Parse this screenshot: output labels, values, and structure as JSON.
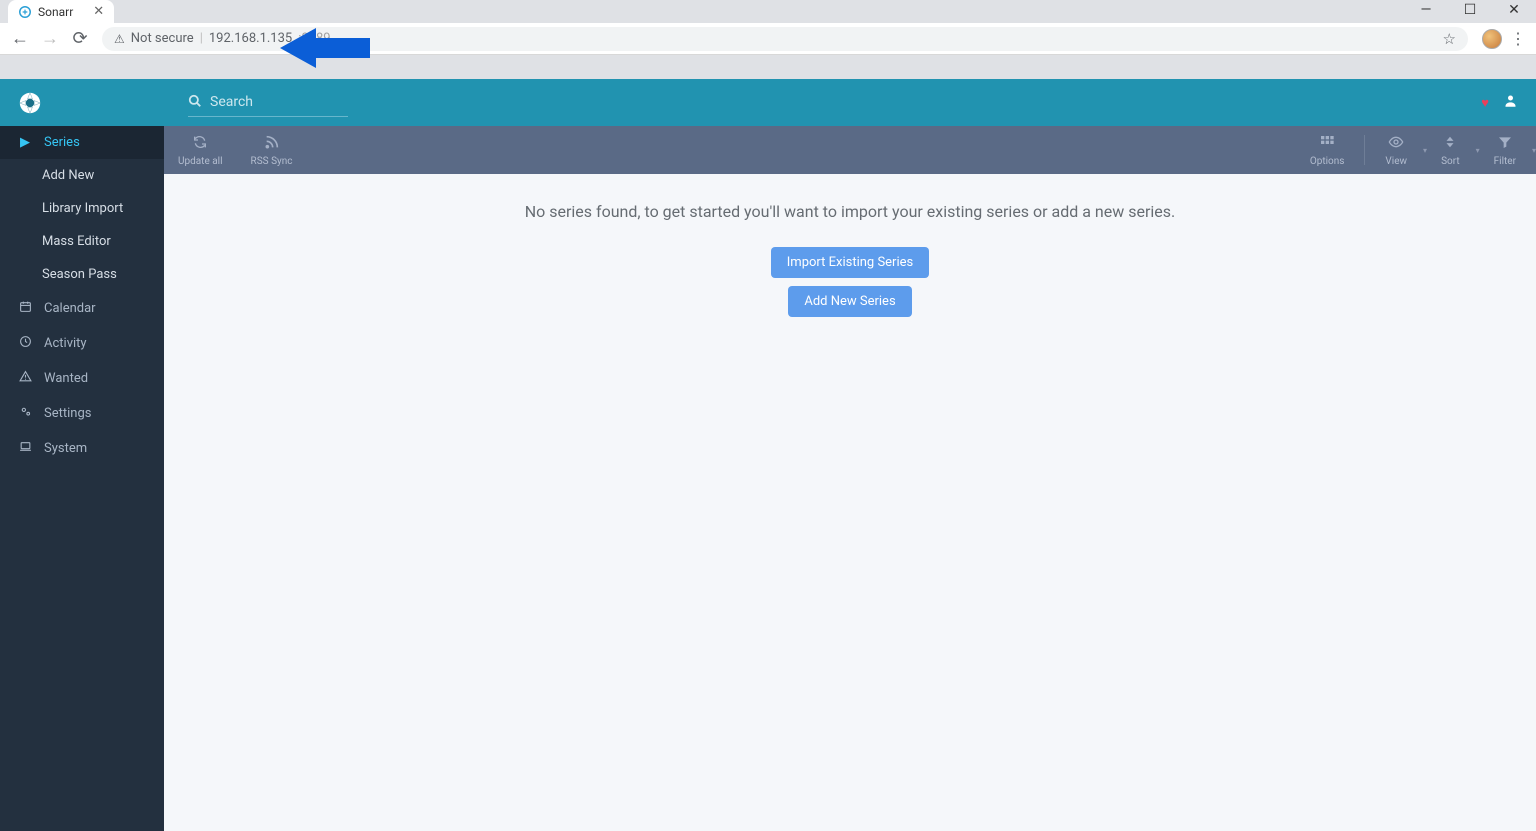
{
  "browser": {
    "tab_title": "Sonarr",
    "not_secure": "Not secure",
    "url_host": "192.168.1.135",
    "url_port": ":8989"
  },
  "app_header": {
    "search_placeholder": "Search"
  },
  "sidebar": {
    "series": "Series",
    "add_new": "Add New",
    "library_import": "Library Import",
    "mass_editor": "Mass Editor",
    "season_pass": "Season Pass",
    "calendar": "Calendar",
    "activity": "Activity",
    "wanted": "Wanted",
    "settings": "Settings",
    "system": "System"
  },
  "toolbar": {
    "update_all": "Update all",
    "rss_sync": "RSS Sync",
    "options": "Options",
    "view": "View",
    "sort": "Sort",
    "filter": "Filter"
  },
  "main": {
    "empty_message": "No series found, to get started you'll want to import your existing series or add a new series.",
    "import_button": "Import Existing Series",
    "add_button": "Add New Series"
  }
}
